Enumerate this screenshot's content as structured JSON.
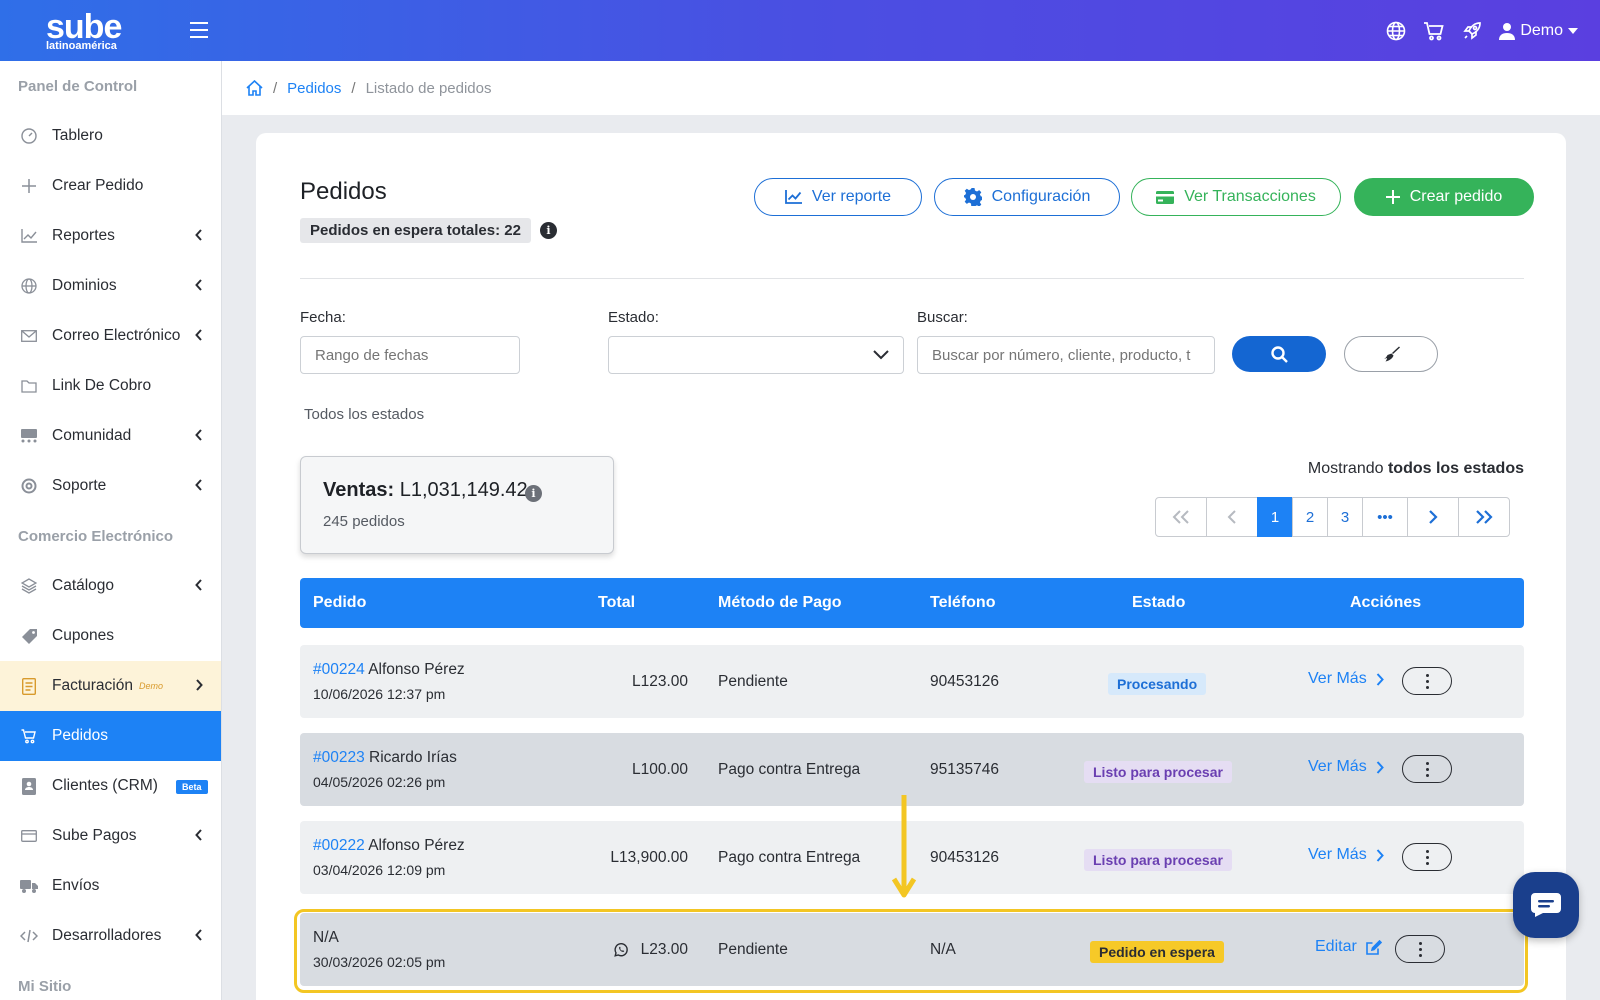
{
  "brand": {
    "name": "sube",
    "tagline": "latinoamérica"
  },
  "topbar": {
    "user_name": "Demo",
    "icons": [
      "globe-icon",
      "cart-icon",
      "rocket-icon",
      "user-icon"
    ]
  },
  "sidebar": {
    "sections": [
      {
        "title": "Panel de Control"
      },
      {
        "title": "Comercio Electrónico"
      },
      {
        "title": "Mi Sitio"
      }
    ],
    "items": [
      {
        "label": "Tablero",
        "icon": "dashboard-icon"
      },
      {
        "label": "Crear Pedido",
        "icon": "plus-icon"
      },
      {
        "label": "Reportes",
        "icon": "chart-icon"
      },
      {
        "label": "Dominios",
        "icon": "globe-icon"
      },
      {
        "label": "Correo Electrónico",
        "icon": "envelope-icon"
      },
      {
        "label": "Link De Cobro",
        "icon": "folder-icon"
      },
      {
        "label": "Comunidad",
        "icon": "community-icon"
      },
      {
        "label": "Soporte",
        "icon": "lifebuoy-icon"
      },
      {
        "label": "Catálogo",
        "icon": "layers-icon"
      },
      {
        "label": "Cupones",
        "icon": "tag-icon"
      },
      {
        "label": "Facturación",
        "icon": "invoice-icon",
        "badge": "Demo"
      },
      {
        "label": "Pedidos",
        "icon": "cart-icon"
      },
      {
        "label": "Clientes (CRM)",
        "icon": "contact-icon",
        "badge": "Beta"
      },
      {
        "label": "Sube Pagos",
        "icon": "card-icon"
      },
      {
        "label": "Envíos",
        "icon": "truck-icon"
      },
      {
        "label": "Desarrolladores",
        "icon": "code-icon"
      }
    ]
  },
  "breadcrumb": {
    "items": [
      "Pedidos",
      "Listado de pedidos"
    ],
    "separator": "/"
  },
  "page": {
    "title": "Pedidos",
    "pending_badge": "Pedidos en espera totales: 22",
    "buttons": {
      "reporte": "Ver reporte",
      "config": "Configuración",
      "transacciones": "Ver Transacciones",
      "crear": "Crear pedido"
    }
  },
  "filters": {
    "fecha_label": "Fecha:",
    "fecha_placeholder": "Rango de fechas",
    "estado_label": "Estado:",
    "estado_value": "",
    "buscar_label": "Buscar:",
    "buscar_placeholder": "Buscar por número, cliente, producto, t",
    "all_states": "Todos los estados"
  },
  "sales": {
    "label": "Ventas:",
    "amount": "L1,031,149.42",
    "orders": "245 pedidos"
  },
  "showing": {
    "prefix": "Mostrando",
    "value": "todos los estados"
  },
  "pagination": {
    "pages": [
      "1",
      "2",
      "3"
    ],
    "current": "1",
    "ellipsis": "•••"
  },
  "table": {
    "headers": [
      "Pedido",
      "Total",
      "Método de Pago",
      "Teléfono",
      "Estado",
      "Acciónes"
    ],
    "rows": [
      {
        "order_id": "#00224",
        "customer": "Alfonso Pérez",
        "date": "10/06/2026 12:37 pm",
        "total": "L123.00",
        "payment": "Pendiente",
        "phone": "90453126",
        "status": "Procesando",
        "action": "Ver Más"
      },
      {
        "order_id": "#00223",
        "customer": "Ricardo Irías",
        "date": "04/05/2026 02:26 pm",
        "total": "L100.00",
        "payment": "Pago contra Entrega",
        "phone": "95135746",
        "status": "Listo para procesar",
        "action": "Ver Más"
      },
      {
        "order_id": "#00222",
        "customer": "Alfonso Pérez",
        "date": "03/04/2026 12:09 pm",
        "total": "L13,900.00",
        "payment": "Pago contra Entrega",
        "phone": "90453126",
        "status": "Listo para procesar",
        "action": "Ver Más"
      },
      {
        "order_id": "N/A",
        "customer": "",
        "date": "30/03/2026 02:05 pm",
        "total": "L23.00",
        "payment": "Pendiente",
        "phone": "N/A",
        "status": "Pedido en espera",
        "action": "Editar"
      }
    ]
  },
  "colors": {
    "primary": "#1d82f5",
    "success": "#35b35a",
    "highlight": "#f3c623",
    "status_processing": "#d6e9fb",
    "status_ready": "#e5ddf3",
    "status_waiting": "#f6c928"
  }
}
